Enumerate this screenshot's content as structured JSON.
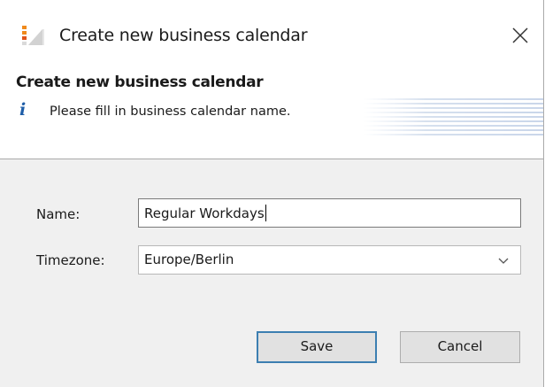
{
  "window": {
    "title": "Create new business calendar"
  },
  "header": {
    "title": "Create new business calendar",
    "message": "Please fill in business calendar name."
  },
  "form": {
    "name_label": "Name:",
    "name_value": "Regular Workdays",
    "timezone_label": "Timezone:",
    "timezone_value": "Europe/Berlin"
  },
  "buttons": {
    "save_label": "Save",
    "cancel_label": "Cancel"
  },
  "icons": {
    "app": "app-icon",
    "close": "close-icon",
    "info": "info-icon",
    "dropdown": "chevron-down-icon"
  },
  "colors": {
    "info_blue": "#1f5ea8",
    "default_button_border": "#3c7fb1",
    "dialog_background": "#f0f0f0"
  }
}
